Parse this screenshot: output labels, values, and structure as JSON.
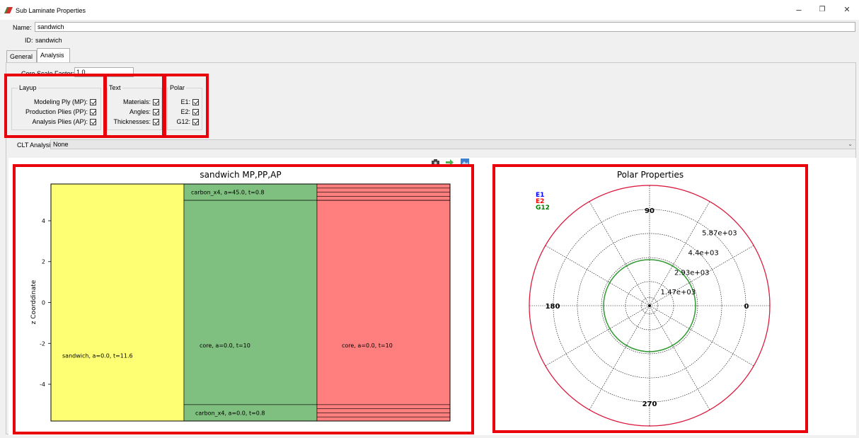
{
  "window": {
    "title": "Sub Laminate Properties",
    "minimize": "–",
    "restore": "❐",
    "close": "✕"
  },
  "header": {
    "name_label": "Name:",
    "name_value": "sandwich",
    "id_label": "ID:",
    "id_value": "sandwich"
  },
  "tabs": [
    "General",
    "Analysis"
  ],
  "analysis": {
    "core_scale_label": "Core Scale Factor:",
    "core_scale_value": "1.0",
    "layup": {
      "title": "Layup",
      "items": [
        "Modeling Ply (MP):",
        "Production Plies (PP):",
        "Analysis Plies (AP):"
      ]
    },
    "text": {
      "title": "Text",
      "items": [
        "Materials:",
        "Angles:",
        "Thicknesses:"
      ]
    },
    "polar": {
      "title": "Polar",
      "items": [
        "E1:",
        "E2:",
        "G12:"
      ]
    },
    "clt_label": "CLT Analysis:",
    "clt_value": "None"
  },
  "colors": {
    "highlight": "#e8000b",
    "mp": "#ffff73",
    "pp": "#7fbf7f",
    "ap": "#ff7f7f",
    "e1": "#0000ff",
    "e2": "#ff0000",
    "g12": "#008000"
  },
  "toolbar_icons": [
    "camera-icon",
    "export-arrow-icon",
    "image-icon"
  ],
  "chart_data": [
    {
      "type": "bar",
      "title": "sandwich MP,PP,AP",
      "ylabel": "z Coorddinate",
      "yticks": [
        "4",
        "2",
        "0",
        "-2",
        "-4"
      ],
      "ylim": [
        -5.8,
        5.8
      ],
      "columns": [
        "MP",
        "PP",
        "AP"
      ],
      "regions": [
        {
          "column": "MP",
          "z": [
            -5.8,
            5.8
          ],
          "label": "sandwich, a=0.0, t=11.6"
        },
        {
          "column": "PP",
          "z": [
            5.0,
            5.8
          ],
          "label": "carbon_x4, a=45.0, t=0.8"
        },
        {
          "column": "PP",
          "z": [
            -5.0,
            5.0
          ],
          "label": "core, a=0.0, t=10"
        },
        {
          "column": "PP",
          "z": [
            -5.8,
            -5.0
          ],
          "label": "carbon_x4, a=0.0, t=0.8"
        },
        {
          "column": "AP",
          "z": [
            -5.0,
            5.0
          ],
          "label": "core, a=0.0, t=10"
        }
      ],
      "ap_ply_lines_top": [
        5.0,
        5.2,
        5.4,
        5.6
      ],
      "ap_ply_lines_bottom": [
        -5.2,
        -5.4,
        -5.6
      ]
    },
    {
      "type": "polar",
      "title": "Polar Properties",
      "legend": [
        "E1",
        "E2",
        "G12"
      ],
      "angle_labels": [
        "90",
        "180",
        "0",
        "270"
      ],
      "radial_labels": [
        "1.47e+03",
        "2.93e+03",
        "4.4e+03",
        "5.87e+03"
      ],
      "radial_values": [
        1470,
        2930,
        4400,
        5870
      ],
      "rmax": 7330,
      "series": [
        {
          "name": "E1",
          "radius": 7330
        },
        {
          "name": "E2",
          "radius": 7330
        },
        {
          "name": "G12",
          "radius": 2800
        }
      ]
    }
  ]
}
